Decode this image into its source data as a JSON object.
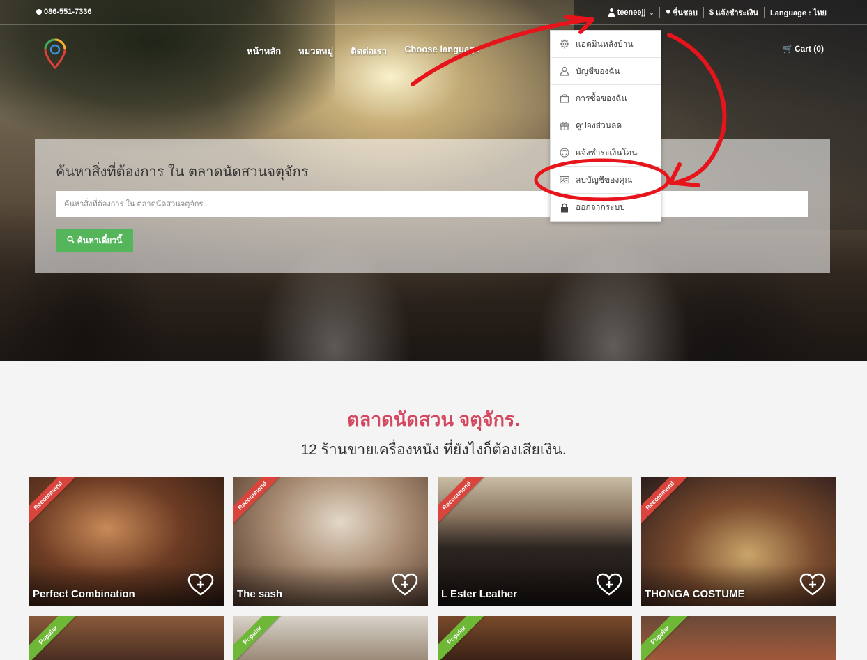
{
  "topbar": {
    "phone": "086-551-7336",
    "user": "teeneejj",
    "favorites": "ชื่นชอบ",
    "payment_notice": "แจ้งชำระเงิน",
    "payment_symbol": "$",
    "language": "Language : ไทย"
  },
  "nav": {
    "items": [
      "หน้าหลัก",
      "หมวดหมู่",
      "ติดต่อเรา",
      "Choose language"
    ],
    "cart": "Cart (0)"
  },
  "search": {
    "title": "ค้นหาสิ่งที่ต้องการ ใน ตลาดนัดสวนจตุจักร",
    "placeholder": "ค้นหาสิ่งที่ต้องการ ใน ตลาดนัดสวนจตุจักร...",
    "button": "ค้นหาเดี๋ยวนี้"
  },
  "dropdown": {
    "items": [
      {
        "label": "แอดมินหลังบ้าน",
        "icon": "gear-icon"
      },
      {
        "label": "บัญชีของฉัน",
        "icon": "user-outline-icon"
      },
      {
        "label": "การซื้อของฉัน",
        "icon": "shopping-bag-icon"
      },
      {
        "label": "คูปองส่วนลด",
        "icon": "gift-icon"
      },
      {
        "label": "แจ้งชำระเงินโอน",
        "icon": "coin-icon"
      },
      {
        "label": "ลบบัญชีของคุณ",
        "icon": "id-card-icon"
      },
      {
        "label": "ออกจากระบบ",
        "icon": "lock-icon"
      }
    ]
  },
  "section": {
    "title": "ตลาดนัดสวน จตุจักร.",
    "subtitle": "12 ร้านขายเครื่องหนัง ที่ยังไงก็ต้องเสียเงิน."
  },
  "shops": [
    {
      "name": "Perfect Combination",
      "badge": "Recommend"
    },
    {
      "name": "The sash",
      "badge": "Recommend"
    },
    {
      "name": "L Ester Leather",
      "badge": "Recommend"
    },
    {
      "name": "THONGA COSTUME",
      "badge": "Recommend"
    }
  ],
  "shops_row2": [
    {
      "badge": "Popular"
    },
    {
      "badge": "Popular"
    },
    {
      "badge": "Popular"
    },
    {
      "badge": "Popular"
    }
  ],
  "colors": {
    "accent_red": "#d4475e",
    "search_green": "#55b55b",
    "ribbon_red": "#d9453d",
    "ribbon_green": "#6fb736",
    "annotation_red": "#e8141b"
  }
}
